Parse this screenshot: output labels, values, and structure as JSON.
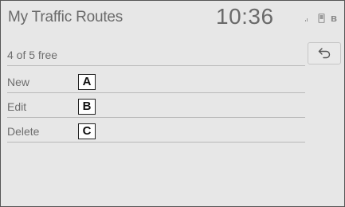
{
  "header": {
    "title": "My Traffic Routes",
    "clock": "10:36",
    "status_icons": [
      "signal-icon",
      "phone-icon",
      "bluetooth-icon"
    ],
    "bluetooth_glyph": "ʙ"
  },
  "capacity": {
    "label": "4 of 5 free"
  },
  "menu": {
    "items": [
      {
        "label": "New",
        "callout": "A"
      },
      {
        "label": "Edit",
        "callout": "B"
      },
      {
        "label": "Delete",
        "callout": "C"
      }
    ]
  },
  "back_button": {
    "icon": "back-arrow-icon"
  },
  "colors": {
    "background": "#e7e7e7",
    "text": "#6e6e6e",
    "divider": "#b9b9b9",
    "callout_border": "#222222"
  }
}
